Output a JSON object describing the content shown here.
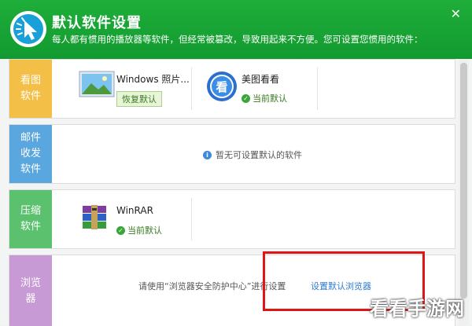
{
  "header": {
    "title": "默认软件设置",
    "subtitle": "每人都有惯用的播放器等软件，但经常被篡改，导致用起来不方便。您可设置您惯用的软件：",
    "close_icon": "close-icon",
    "accent": "#1fae39"
  },
  "categories": [
    {
      "label": "看图软件",
      "color": "#f4bf47",
      "apps": [
        {
          "name": "Windows 照片...",
          "action": "恢复默认",
          "icon": "windows-photo-icon"
        },
        {
          "name": "美图看看",
          "status": "当前默认",
          "icon": "meitu-viewer-icon"
        }
      ]
    },
    {
      "label": "邮件收发软件",
      "color": "#5aa6de",
      "message": "暂无可设置默认的软件"
    },
    {
      "label": "压缩软件",
      "color": "#5cc16e",
      "apps": [
        {
          "name": "WinRAR",
          "status": "当前默认",
          "icon": "winrar-icon"
        }
      ]
    },
    {
      "label": "浏览器",
      "color": "#c79ad6",
      "message": "请使用“浏览器安全防护中心”进行设置",
      "link": "设置默认浏览器"
    }
  ],
  "watermark": "看看手游网"
}
